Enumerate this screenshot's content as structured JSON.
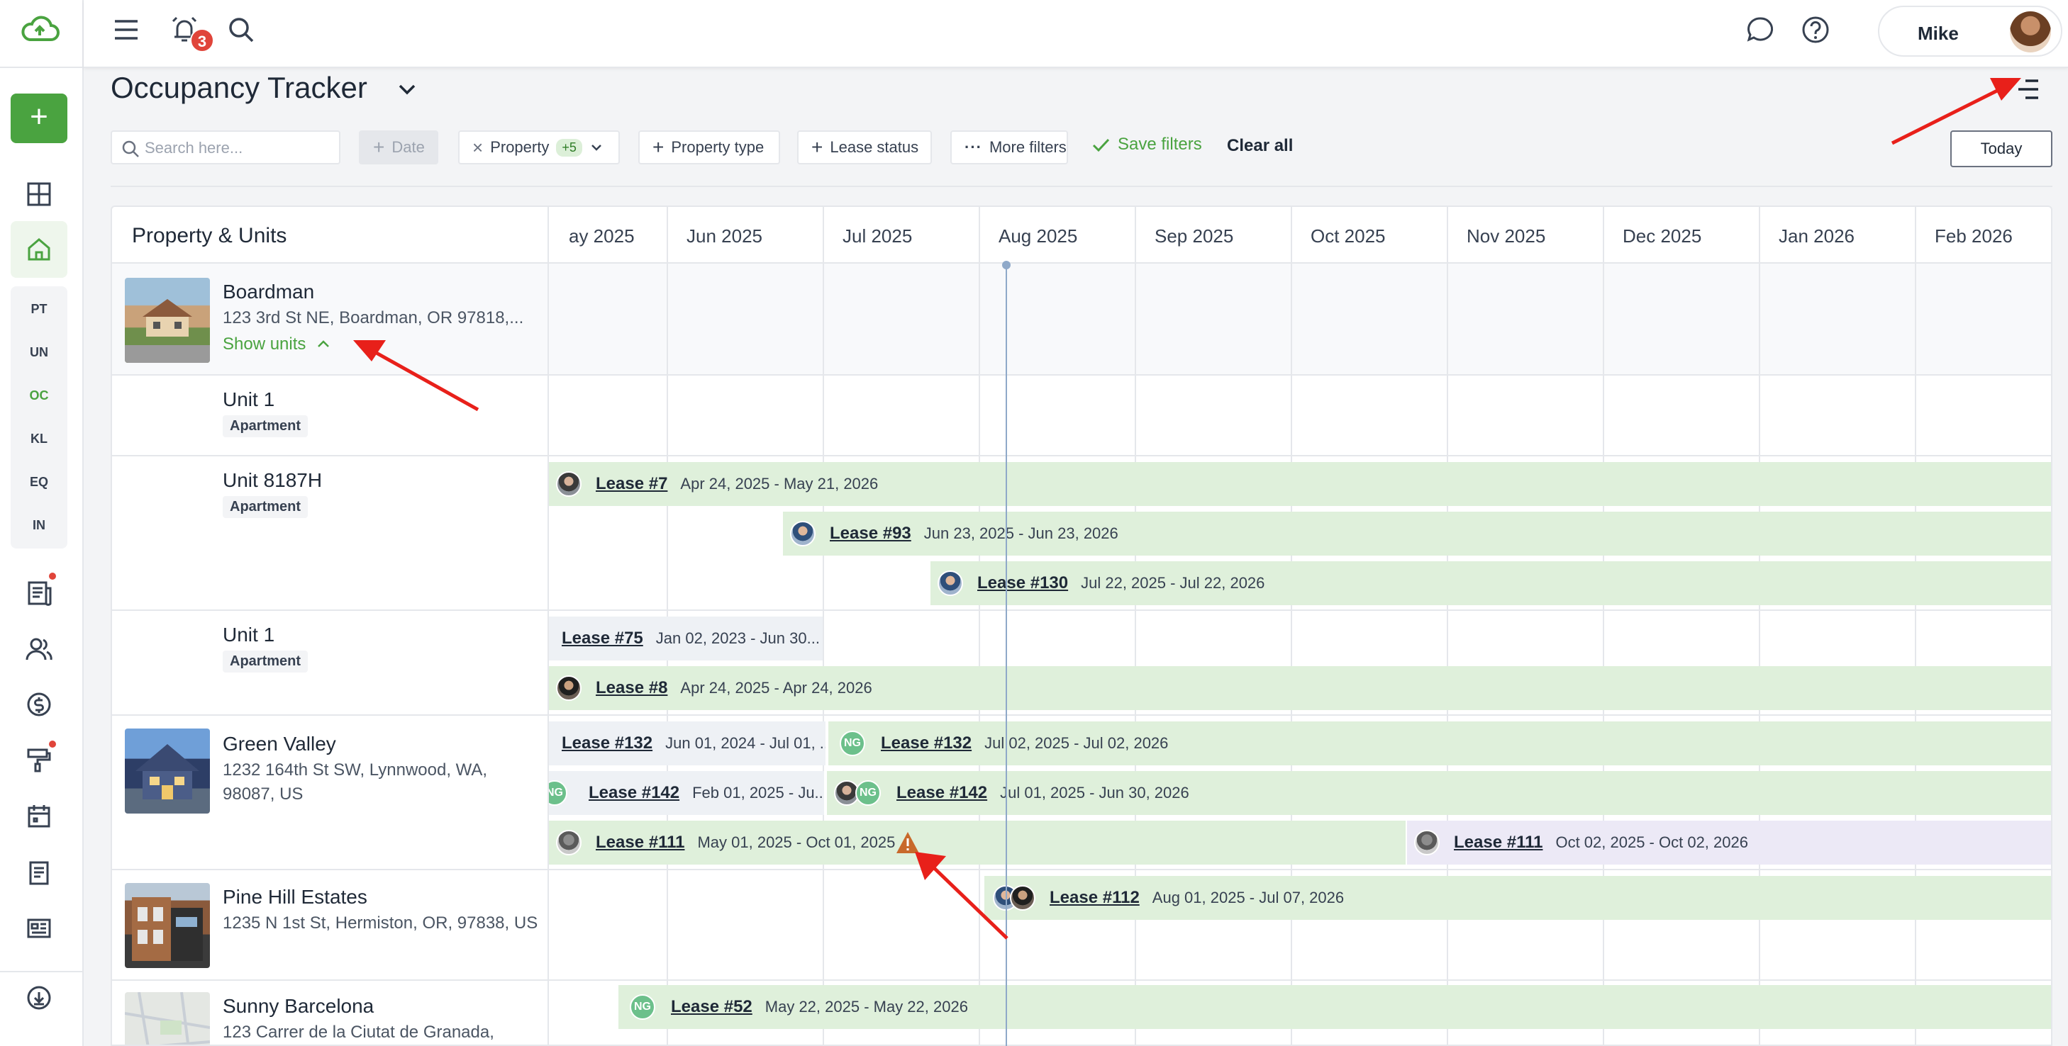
{
  "topbar": {
    "notification_count": "3",
    "user_name": "Mike"
  },
  "rail": {
    "add_label": "+",
    "items": [
      "PT",
      "UN",
      "OC",
      "KL",
      "EQ",
      "IN"
    ],
    "active_item": "OC"
  },
  "page": {
    "title": "Occupancy Tracker"
  },
  "filters": {
    "search_placeholder": "Search here...",
    "date_label": "Date",
    "property_label": "Property",
    "property_count": "+5",
    "property_type_label": "Property type",
    "lease_status_label": "Lease status",
    "more_filters_label": "More filters",
    "save_filters_label": "Save filters",
    "clear_all_label": "Clear all",
    "today_label": "Today"
  },
  "table": {
    "left_header": "Property & Units",
    "months": [
      "ay 2025",
      "Jun 2025",
      "Jul 2025",
      "Aug 2025",
      "Sep 2025",
      "Oct 2025",
      "Nov 2025",
      "Dec 2025",
      "Jan 2026",
      "Feb 2026"
    ]
  },
  "properties": [
    {
      "name": "Boardman",
      "address": "123 3rd St NE, Boardman, OR 97818,...",
      "show_units": "Show units",
      "units": [
        {
          "name": "Unit 1",
          "type": "Apartment"
        },
        {
          "name": "Unit 8187H",
          "type": "Apartment"
        },
        {
          "name": "Unit 1",
          "type": "Apartment"
        }
      ]
    },
    {
      "name": "Green Valley",
      "address_line1": "1232 164th St SW, Lynnwood, WA,",
      "address_line2": "98087, US"
    },
    {
      "name": "Pine Hill Estates",
      "address": "1235 N 1st St, Hermiston, OR, 97838, US"
    },
    {
      "name": "Sunny Barcelona",
      "address": "123 Carrer de la Ciutat de Granada,"
    }
  ],
  "leases": {
    "l7": {
      "label": "Lease #7",
      "dates": "Apr 24, 2025 - May 21, 2026"
    },
    "l93": {
      "label": "Lease #93",
      "dates": "Jun 23, 2025 - Jun 23, 2026"
    },
    "l130": {
      "label": "Lease #130",
      "dates": "Jul 22, 2025 - Jul 22, 2026"
    },
    "l75": {
      "label": "Lease #75",
      "dates": "Jan 02, 2023 - Jun 30..."
    },
    "l8": {
      "label": "Lease #8",
      "dates": "Apr 24, 2025 - Apr 24, 2026"
    },
    "l132a": {
      "label": "Lease #132",
      "dates": "Jun 01, 2024 - Jul 01, ..."
    },
    "l132b": {
      "label": "Lease #132",
      "dates": "Jul 02, 2025 - Jul 02, 2026"
    },
    "l142a": {
      "label": "Lease #142",
      "dates": "Feb 01, 2025 - Ju..."
    },
    "l142b": {
      "label": "Lease #142",
      "dates": "Jul 01, 2025 - Jun 30, 2026"
    },
    "l111a": {
      "label": "Lease #111",
      "dates": "May 01, 2025 - Oct 01, 2025"
    },
    "l111b": {
      "label": "Lease #111",
      "dates": "Oct 02, 2025 - Oct 02, 2026"
    },
    "l112": {
      "label": "Lease #112",
      "dates": "Aug 01, 2025 - Jul 07, 2026"
    },
    "l52": {
      "label": "Lease #52",
      "dates": "May 22, 2025 - May 22, 2026"
    }
  },
  "avatars": {
    "initials": "NG"
  },
  "colors": {
    "accent": "#4aa340",
    "lease_bar": "#dff0db",
    "lease_bar_future": "#ece9f6",
    "alert": "#e0443a",
    "warning": "#c8692b",
    "today_line": "#8fa9c9"
  }
}
